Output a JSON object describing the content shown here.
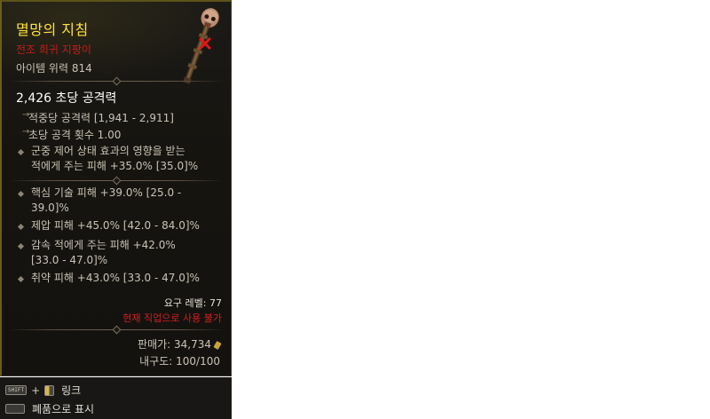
{
  "item": {
    "name": "멸망의 지침",
    "rarity_type": "전조 희귀 지팡이",
    "item_power": "아이템 위력 814",
    "dps": "2,426 초당 공격력",
    "damage_per_hit": "적중당 공격력 [1,941 - 2,911]",
    "attacks_per_second": "초당 공격 횟수 1.00",
    "implicit_affix": [
      "군중 제어 상태 효과의 영향을 받는",
      "적에게 주는 피해 +35.0% [35.0]%"
    ],
    "affixes": [
      [
        "핵심 기술 피해 +39.0% [25.0 -",
        "39.0]%"
      ],
      [
        "제압 피해 +45.0% [42.0 - 84.0]%"
      ],
      [
        "감속 적에게 주는 피해 +42.0%",
        "[33.0 - 47.0]%"
      ],
      [
        "취약 피해 +43.0% [33.0 - 47.0]%"
      ]
    ],
    "required_level": "요구 레벨: 77",
    "class_restriction": "현재 직업으로 사용 불가",
    "sell_value": "판매가: 34,734",
    "durability": "내구도: 100/100"
  },
  "colors": {
    "name": "#ffe23c",
    "rarity": "#c11e1e",
    "restriction": "#d11f1f",
    "text": "#c9c3b5"
  },
  "hints": {
    "link_key": "SHIFT",
    "link_label": "링크",
    "currency_label": "폐품으로 표시"
  },
  "icons": [
    "skull-staff-icon",
    "cannot-use-x-icon",
    "gold-coin-icon",
    "shift-key-icon",
    "left-mouse-icon",
    "keyboard-key-icon"
  ]
}
